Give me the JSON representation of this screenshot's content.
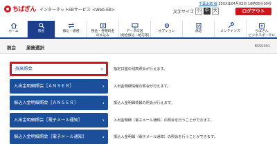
{
  "header": {
    "logo_text": "ちばぎん",
    "service_title": "インターネットEBサービス <Web-EB>",
    "user_name": "千葉太郎 様",
    "last_login": "20XX年04月02日 10時00分00秒",
    "font_size_label": "文字サイズ",
    "font_sizes": [
      "小",
      "中",
      "大"
    ],
    "active_font_size": "中",
    "logout_label": "ログアウト"
  },
  "nav": {
    "items": [
      {
        "label": "ホーム",
        "icon": "home-icon"
      },
      {
        "label": "照会",
        "icon": "magnifier-icon",
        "active": true
      },
      {
        "label": "振込・振替",
        "icon": "transfer-icon"
      },
      {
        "label": "税金・各種料金\nの払込み",
        "icon": "tax-payment-icon"
      },
      {
        "label": "データ伝送\n(総合振込・給与等)",
        "icon": "data-transmission-icon"
      },
      {
        "label": "オプション",
        "icon": "option-gear-icon"
      },
      {
        "label": "承認",
        "icon": "approval-icon"
      },
      {
        "label": "メンテナンス",
        "icon": "maintenance-icon"
      },
      {
        "label": "ちばぎん\nビジネスポータル",
        "icon": "portal-icon"
      }
    ]
  },
  "page": {
    "crumb_1": "照会",
    "crumb_2": "業務選択",
    "screen_id": "BSSK001"
  },
  "menu": [
    {
      "label": "残高照会",
      "description": "指定口座の残高照会が行えます。"
    },
    {
      "label": "入出金明細照会［ＡＮＳＥＲ］",
      "description": "入出金明細情報の照会が行えます。"
    },
    {
      "label": "振込入金明細照会［ＡＮＳＥＲ］",
      "description": "振込入金明細情報の照会が行えます。"
    },
    {
      "label": "入出金明細照会［電子メール通知］",
      "description": "入出金明細（電子メール通知）の照会を行うことができます。"
    },
    {
      "label": "振込入金明細照会［電子メール通知］",
      "description": "振込入金明細（電子メール通知）の照会を行うことができます。"
    }
  ],
  "colors": {
    "brand_red": "#d3141b",
    "nav_blue": "#1b3f8b",
    "button_blue": "#1b4f9a"
  }
}
